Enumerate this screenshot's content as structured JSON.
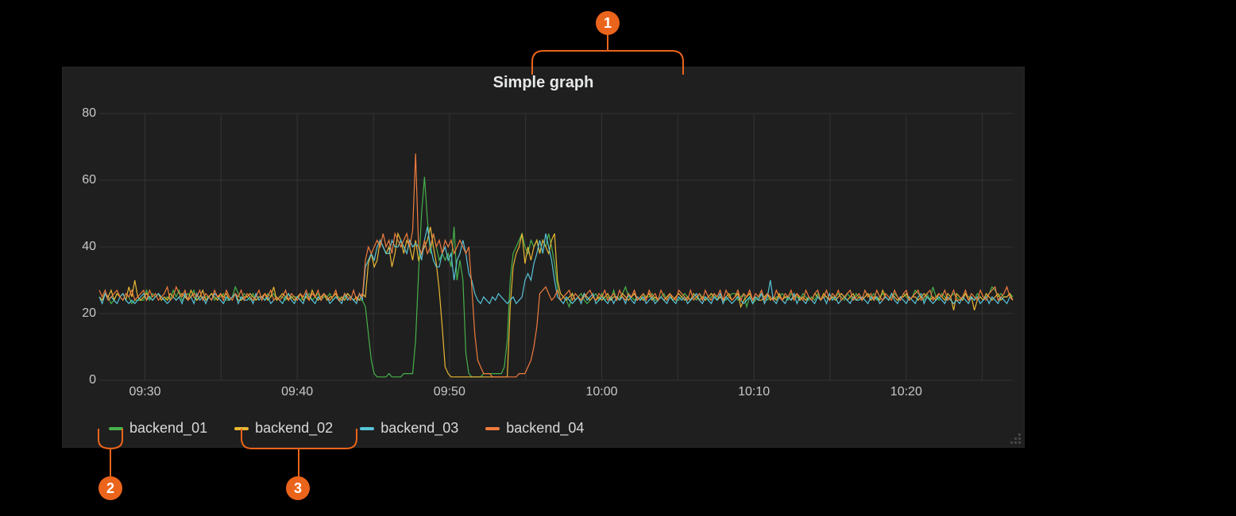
{
  "panel": {
    "title": "Simple graph"
  },
  "legend": [
    {
      "name": "backend_01",
      "color": "#46b14a"
    },
    {
      "name": "backend_02",
      "color": "#e9b633"
    },
    {
      "name": "backend_03",
      "color": "#57c3d8"
    },
    {
      "name": "backend_04",
      "color": "#ef7b3d"
    }
  ],
  "callouts": {
    "1": "1",
    "2": "2",
    "3": "3"
  },
  "chart_data": {
    "type": "line",
    "title": "Simple graph",
    "xlabel": "",
    "ylabel": "",
    "ylim": [
      0,
      80
    ],
    "x_ticks": [
      "09:30",
      "09:40",
      "09:50",
      "10:00",
      "10:10",
      "10:20"
    ],
    "x_tick_positions_min": [
      3,
      13,
      23,
      33,
      43,
      53
    ],
    "x_range_min": [
      0,
      60
    ],
    "y_ticks": [
      0,
      20,
      40,
      60,
      80
    ],
    "series": [
      {
        "name": "backend_01",
        "color": "#46b14a",
        "values": [
          25,
          24,
          26,
          25,
          23,
          24,
          26,
          25,
          24,
          26,
          25,
          23,
          24,
          24,
          24,
          24,
          27,
          24,
          26,
          25,
          26,
          25,
          24,
          25,
          24,
          27,
          25,
          27,
          24,
          25,
          26,
          25,
          27,
          24,
          25,
          25,
          25,
          25,
          26,
          24,
          25,
          25,
          26,
          24,
          24,
          25,
          28,
          26,
          24,
          26,
          25,
          24,
          26,
          24,
          25,
          25,
          24,
          26,
          25,
          26,
          24,
          25,
          25,
          24,
          26,
          25,
          25,
          25,
          24,
          25,
          25,
          26,
          24,
          25,
          26,
          24,
          25,
          25,
          26,
          24,
          25,
          25,
          24,
          25,
          26,
          25,
          24,
          25,
          24,
          24,
          22,
          14,
          6,
          2,
          1,
          1,
          1,
          1,
          2,
          1,
          1,
          1,
          1,
          2,
          2,
          2,
          2,
          12,
          32,
          50,
          61,
          48,
          38,
          44,
          40,
          36,
          38,
          36,
          38,
          34,
          46,
          30,
          36,
          30,
          8,
          2,
          1,
          1,
          1,
          1,
          2,
          2,
          2,
          2,
          2,
          2,
          2,
          4,
          12,
          30,
          38,
          40,
          42,
          44,
          40,
          38,
          42,
          40,
          42,
          38,
          42,
          40,
          44,
          40,
          35,
          28,
          24,
          25,
          24,
          22,
          26,
          24,
          25,
          26,
          24,
          23,
          24,
          25,
          26,
          24,
          26,
          24,
          25,
          24,
          27,
          24,
          25,
          26,
          28,
          25,
          25,
          24,
          25,
          24,
          26,
          25,
          25,
          26,
          24,
          24,
          25,
          26,
          24,
          26,
          25,
          24,
          24,
          25,
          26,
          25,
          24,
          25,
          24,
          26,
          25,
          25,
          24,
          25,
          26,
          24,
          25,
          24,
          24,
          25,
          26,
          26,
          24,
          25,
          26,
          22,
          25,
          23,
          24,
          25,
          26,
          25,
          24,
          25,
          24,
          25,
          25,
          26,
          25,
          24,
          26,
          25,
          25,
          24,
          26,
          25,
          24,
          25,
          24,
          26,
          24,
          25,
          25,
          24,
          25,
          25,
          26,
          25,
          24,
          26,
          25,
          24,
          26,
          25,
          24,
          25,
          26,
          25,
          26,
          24,
          25,
          26,
          25,
          24,
          25,
          26,
          25,
          24,
          26,
          25,
          24,
          25,
          27,
          26,
          25,
          24,
          26,
          24,
          28,
          25,
          24,
          26,
          25,
          24,
          25,
          26,
          25,
          24,
          25,
          26,
          25,
          25,
          24,
          26,
          25,
          24,
          25,
          26,
          28,
          27,
          25,
          26,
          25,
          25,
          26,
          25
        ]
      },
      {
        "name": "backend_02",
        "color": "#e9b633",
        "values": [
          25,
          24,
          26,
          25,
          27,
          24,
          26,
          25,
          26,
          24,
          28,
          25,
          30,
          25,
          24,
          25,
          26,
          25,
          24,
          25,
          26,
          24,
          25,
          24,
          26,
          25,
          24,
          25,
          26,
          25,
          24,
          27,
          25,
          24,
          25,
          27,
          24,
          25,
          26,
          25,
          24,
          26,
          25,
          26,
          24,
          25,
          26,
          24,
          24,
          25,
          25,
          26,
          25,
          24,
          25,
          25,
          26,
          24,
          25,
          28,
          24,
          25,
          26,
          25,
          24,
          25,
          24,
          25,
          26,
          24,
          25,
          24,
          27,
          25,
          24,
          25,
          26,
          24,
          25,
          25,
          26,
          24,
          25,
          24,
          26,
          25,
          24,
          25,
          24,
          26,
          25,
          35,
          38,
          34,
          36,
          42,
          40,
          38,
          40,
          34,
          38,
          44,
          42,
          38,
          42,
          40,
          36,
          42,
          36,
          38,
          40,
          42,
          46,
          40,
          35,
          27,
          16,
          4,
          2,
          1,
          1,
          1,
          1,
          1,
          1,
          1,
          1,
          1,
          1,
          1,
          1,
          1,
          1,
          1,
          1,
          1,
          1,
          1,
          1,
          22,
          34,
          38,
          40,
          44,
          35,
          40,
          36,
          40,
          42,
          38,
          42,
          40,
          38,
          42,
          44,
          30,
          26,
          25,
          24,
          25,
          26,
          24,
          25,
          24,
          26,
          25,
          24,
          25,
          24,
          25,
          24,
          25,
          26,
          24,
          25,
          25,
          24,
          26,
          25,
          24,
          25,
          26,
          24,
          25,
          24,
          25,
          26,
          24,
          25,
          24,
          25,
          24,
          25,
          26,
          24,
          25,
          26,
          25,
          24,
          25,
          24,
          26,
          25,
          24,
          25,
          24,
          25,
          26,
          25,
          24,
          25,
          24,
          25,
          26,
          24,
          25,
          26,
          22,
          24,
          25,
          26,
          24,
          25,
          24,
          24,
          25,
          26,
          24,
          25,
          24,
          26,
          24,
          25,
          25,
          24,
          25,
          26,
          24,
          25,
          24,
          25,
          24,
          26,
          25,
          24,
          26,
          25,
          24,
          25,
          24,
          25,
          26,
          25,
          24,
          25,
          26,
          24,
          25,
          24,
          25,
          26,
          24,
          25,
          25,
          24,
          27,
          25,
          24,
          26,
          25,
          24,
          25,
          25,
          26,
          24,
          25,
          25,
          24,
          25,
          26,
          25,
          24,
          25,
          24,
          26,
          25,
          24,
          26,
          25,
          21,
          26,
          25,
          24,
          26,
          24,
          25,
          21,
          24,
          25,
          24,
          26,
          25,
          24,
          25,
          26,
          24,
          25,
          25,
          26,
          24
        ]
      },
      {
        "name": "backend_03",
        "color": "#57c3d8",
        "values": [
          25,
          23,
          26,
          24,
          25,
          24,
          23,
          25,
          26,
          24,
          23,
          24,
          23,
          24,
          25,
          26,
          24,
          25,
          24,
          25,
          26,
          25,
          24,
          23,
          24,
          25,
          24,
          25,
          23,
          26,
          24,
          25,
          23,
          26,
          24,
          25,
          23,
          25,
          24,
          26,
          25,
          24,
          23,
          25,
          24,
          25,
          26,
          23,
          25,
          24,
          24,
          25,
          23,
          26,
          24,
          25,
          24,
          25,
          23,
          24,
          25,
          24,
          23,
          25,
          26,
          24,
          23,
          25,
          24,
          23,
          26,
          25,
          24,
          23,
          25,
          24,
          26,
          25,
          23,
          24,
          25,
          24,
          23,
          26,
          24,
          25,
          24,
          23,
          26,
          24,
          34,
          36,
          38,
          36,
          40,
          42,
          40,
          38,
          38,
          42,
          40,
          40,
          42,
          40,
          38,
          42,
          40,
          41,
          40,
          36,
          42,
          46,
          40,
          36,
          34,
          34,
          38,
          40,
          36,
          38,
          30,
          36,
          38,
          42,
          38,
          32,
          30,
          26,
          24,
          23,
          25,
          24,
          23,
          25,
          24,
          26,
          25,
          24,
          23,
          24,
          25,
          23,
          24,
          25,
          30,
          32,
          30,
          35,
          38,
          42,
          38,
          44,
          40,
          36,
          30,
          25,
          24,
          23,
          25,
          24,
          23,
          24,
          25,
          23,
          26,
          24,
          25,
          26,
          23,
          24,
          25,
          24,
          23,
          25,
          23,
          25,
          24,
          25,
          23,
          26,
          24,
          23,
          25,
          24,
          25,
          23,
          24,
          25,
          23,
          24,
          25,
          24,
          23,
          25,
          24,
          23,
          25,
          24,
          25,
          23,
          24,
          25,
          26,
          24,
          23,
          25,
          24,
          23,
          25,
          24,
          26,
          23,
          25,
          24,
          23,
          24,
          25,
          24,
          23,
          24,
          25,
          23,
          25,
          24,
          26,
          23,
          25,
          30,
          24,
          23,
          25,
          24,
          23,
          25,
          24,
          26,
          23,
          25,
          24,
          23,
          25,
          24,
          23,
          25,
          24,
          25,
          23,
          26,
          24,
          25,
          23,
          24,
          25,
          24,
          23,
          25,
          24,
          24,
          25,
          24,
          23,
          25,
          24,
          25,
          23,
          24,
          25,
          24,
          26,
          24,
          23,
          25,
          24,
          23,
          25,
          24,
          23,
          25,
          26,
          23,
          25,
          24,
          23,
          24,
          25,
          24,
          23,
          25,
          24,
          23,
          24,
          23,
          25,
          24,
          23,
          25,
          24,
          25,
          23,
          24,
          25,
          23,
          25,
          24,
          23,
          25,
          24,
          23,
          25,
          24
        ]
      },
      {
        "name": "backend_04",
        "color": "#ef7b3d",
        "values": [
          27,
          25,
          27,
          24,
          25,
          26,
          27,
          25,
          24,
          26,
          25,
          27,
          24,
          25,
          26,
          27,
          24,
          27,
          25,
          26,
          24,
          25,
          26,
          28,
          24,
          25,
          28,
          26,
          25,
          27,
          24,
          25,
          26,
          25,
          27,
          24,
          26,
          25,
          24,
          27,
          25,
          26,
          24,
          27,
          25,
          24,
          26,
          25,
          27,
          24,
          26,
          25,
          24,
          25,
          27,
          24,
          26,
          25,
          27,
          24,
          25,
          24,
          25,
          27,
          24,
          26,
          25,
          24,
          26,
          25,
          27,
          24,
          26,
          25,
          27,
          24,
          26,
          25,
          24,
          25,
          27,
          24,
          24,
          26,
          25,
          24,
          27,
          24,
          26,
          25,
          36,
          40,
          38,
          40,
          42,
          40,
          44,
          40,
          42,
          38,
          44,
          42,
          40,
          42,
          44,
          40,
          45,
          68,
          40,
          38,
          42,
          38,
          40,
          44,
          40,
          42,
          38,
          42,
          40,
          42,
          38,
          40,
          42,
          40,
          38,
          40,
          28,
          14,
          6,
          4,
          2,
          2,
          2,
          1,
          1,
          1,
          1,
          1,
          1,
          1,
          1,
          1,
          2,
          2,
          2,
          4,
          6,
          10,
          16,
          26,
          27,
          28,
          26,
          24,
          25,
          27,
          24,
          25,
          26,
          27,
          24,
          26,
          25,
          24,
          25,
          26,
          27,
          25,
          24,
          26,
          25,
          27,
          24,
          25,
          26,
          24,
          27,
          25,
          24,
          26,
          25,
          27,
          24,
          25,
          26,
          24,
          27,
          25,
          26,
          24,
          27,
          25,
          24,
          26,
          25,
          24,
          27,
          26,
          25,
          24,
          27,
          24,
          25,
          26,
          24,
          27,
          25,
          24,
          26,
          25,
          27,
          24,
          27,
          25,
          24,
          25,
          27,
          24,
          26,
          25,
          27,
          24,
          26,
          25,
          27,
          24,
          26,
          25,
          24,
          27,
          25,
          24,
          26,
          25,
          27,
          24,
          26,
          25,
          24,
          27,
          25,
          24,
          26,
          27,
          24,
          25,
          27,
          24,
          26,
          25,
          27,
          24,
          25,
          26,
          27,
          24,
          25,
          26,
          24,
          27,
          25,
          26,
          24,
          27,
          25,
          24,
          26,
          25,
          24,
          27,
          25,
          24,
          26,
          27,
          24,
          25,
          26,
          27,
          24,
          25,
          26,
          27,
          24,
          25,
          26,
          25,
          27,
          24,
          25,
          27,
          24,
          24,
          25,
          27,
          24,
          26,
          25,
          24,
          27,
          25,
          24,
          26,
          27,
          28,
          24,
          25,
          26,
          28,
          25,
          24
        ]
      }
    ]
  }
}
